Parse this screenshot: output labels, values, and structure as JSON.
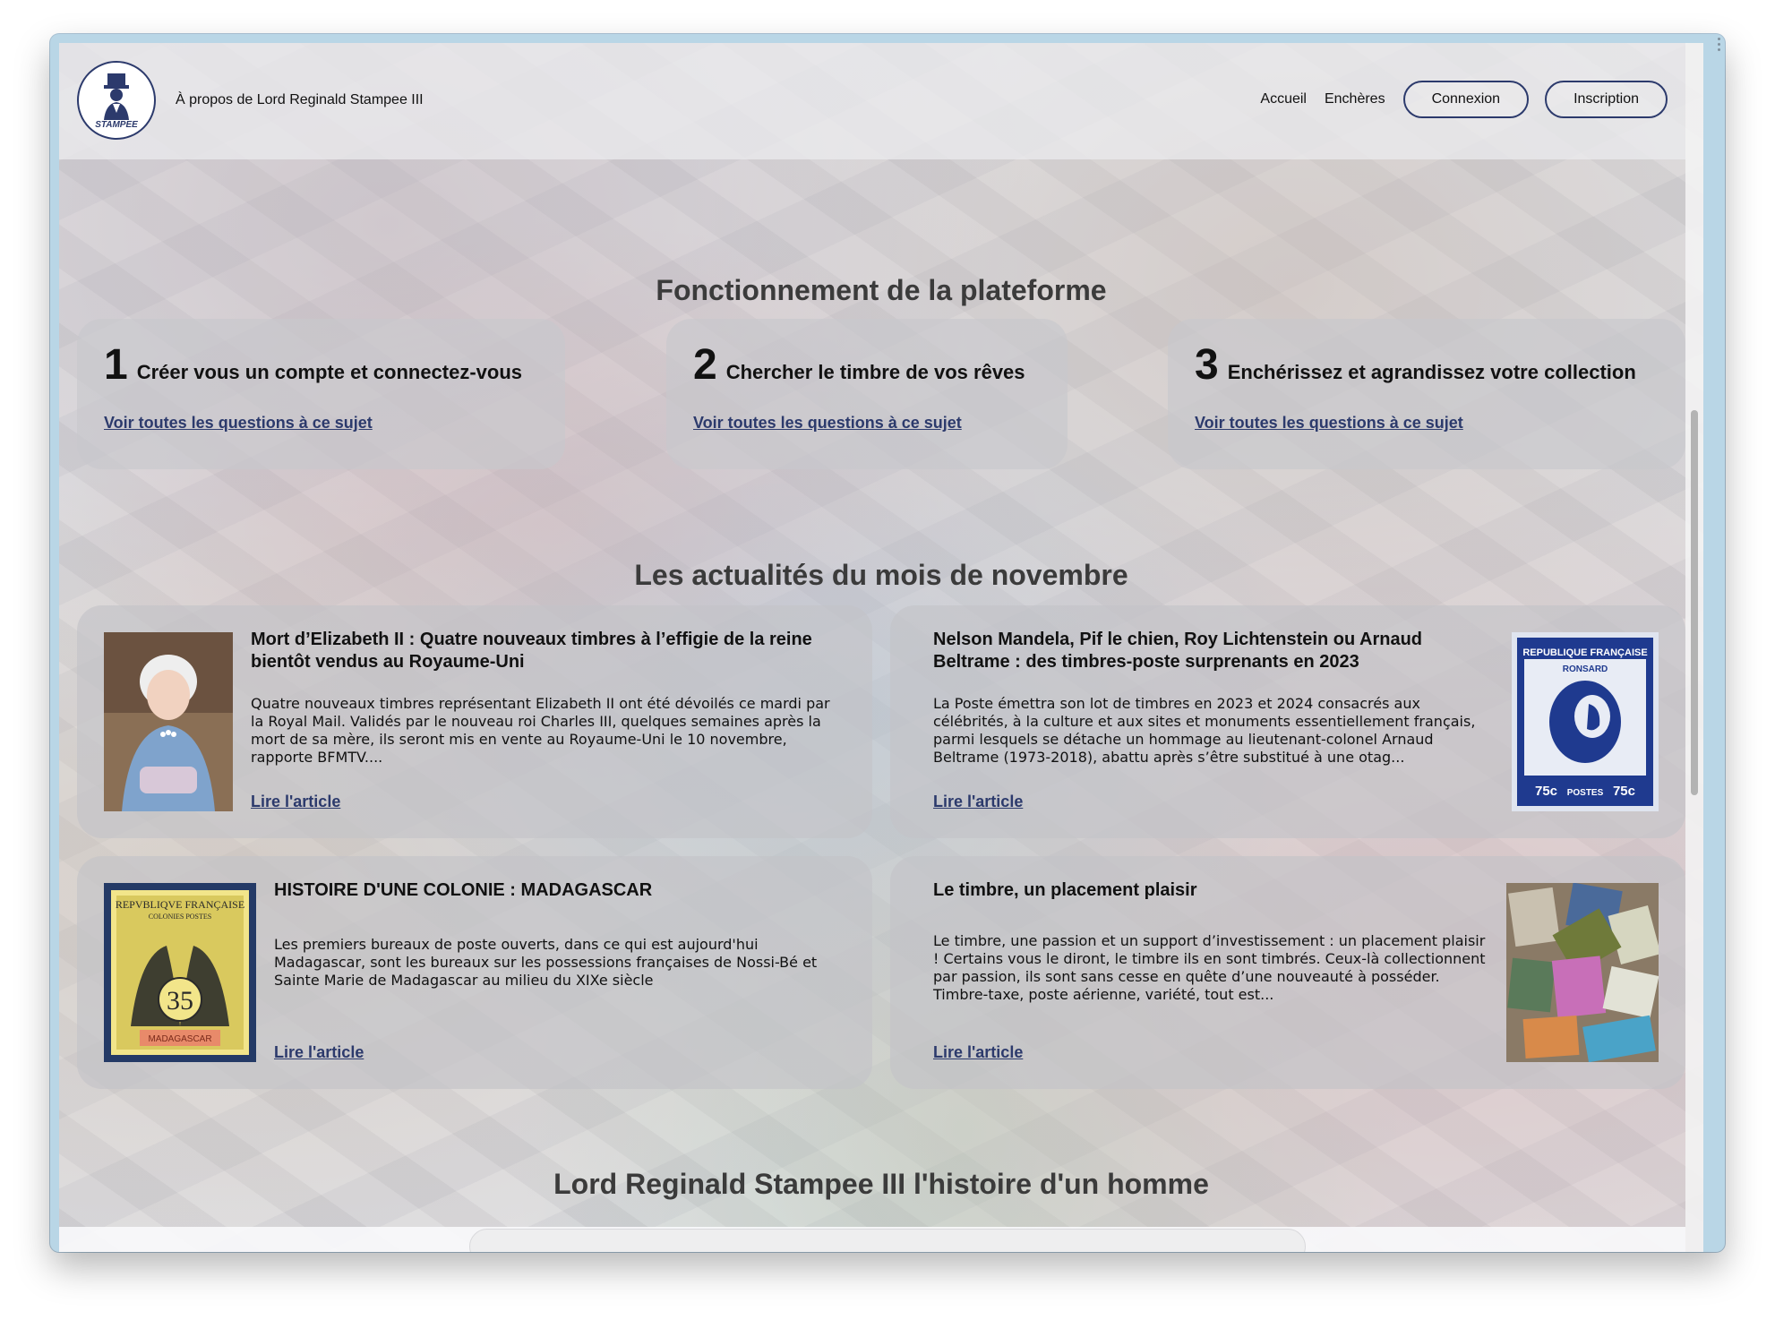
{
  "header": {
    "logo_text": "STAMPEE",
    "about_link": "À propos de Lord Reginald Stampee III",
    "nav": {
      "home": "Accueil",
      "auctions": "Enchères",
      "login": "Connexion",
      "signup": "Inscription"
    }
  },
  "platform": {
    "title": "Fonctionnement de la plateforme",
    "steps": [
      {
        "number": "1",
        "title": "Créer vous un compte et connectez-vous",
        "link": "Voir toutes les questions à ce sujet"
      },
      {
        "number": "2",
        "title": "Chercher le timbre de vos rêves",
        "link": "Voir toutes les questions à ce sujet"
      },
      {
        "number": "3",
        "title": "Enchérissez et agrandissez votre collection",
        "link": "Voir toutes les questions à ce sujet"
      }
    ]
  },
  "news": {
    "title": "Les actualités du mois de novembre",
    "articles": [
      {
        "title": "Mort d’Elizabeth II : Quatre nouveaux timbres à l’effigie de la reine bientôt vendus au Royaume-Uni",
        "body": "Quatre nouveaux timbres représentant Elizabeth II ont été dévoilés ce mardi par la Royal Mail. Validés par le nouveau roi Charles III, quelques semaines après la mort de sa mère, ils seront mis en vente au Royaume-Uni le 10 novembre, rapporte BFMTV....",
        "link": "Lire l'article"
      },
      {
        "title": "Nelson Mandela, Pif le chien, Roy Lichtenstein ou Arnaud Beltrame : des timbres-poste surprenants en 2023",
        "body": "La Poste émettra son lot de timbres en 2023 et 2024 consacrés aux célébrités, à la culture et aux sites et monuments essentiellement français, parmi lesquels se détache un hommage au lieutenant-colonel Arnaud Beltrame (1973-2018), abattu après s’être substitué à une otag...",
        "link": "Lire l'article",
        "stamp": {
          "top": "REPUBLIQUE FRANÇAISE",
          "name": "RONSARD",
          "value": "75c",
          "bottom": "POSTES"
        }
      },
      {
        "title": "HISTOIRE D'UNE COLONIE : MADAGASCAR",
        "body": "Les premiers bureaux de poste ouverts, dans ce qui est aujourd'hui Madagascar, sont les bureaux sur les possessions françaises de Nossi-Bé et Sainte Marie de Madagascar au milieu du XIXe siècle",
        "link": "Lire l'article",
        "stamp": {
          "top": "REPVBLIQVE FRANÇAISE",
          "sub": "COLONIES POSTES",
          "value": "35",
          "bottom": "MADAGASCAR"
        }
      },
      {
        "title": "Le timbre, un placement plaisir",
        "body": "Le timbre, une passion et un support d’investissement : un placement plaisir ! Certains vous le diront, le timbre ils en sont timbrés. Ceux-là collectionnent par passion, ils sont sans cesse en quête d’une nouveauté à posséder. Timbre-taxe, poste aérienne, variété, tout est...",
        "link": "Lire l'article"
      }
    ]
  },
  "history": {
    "title": "Lord Reginald Stampee III l'histoire d'un homme"
  },
  "colors": {
    "accent": "#2c3a6c",
    "card": "#c8c8cd",
    "window_frame": "#b9d6e6"
  }
}
